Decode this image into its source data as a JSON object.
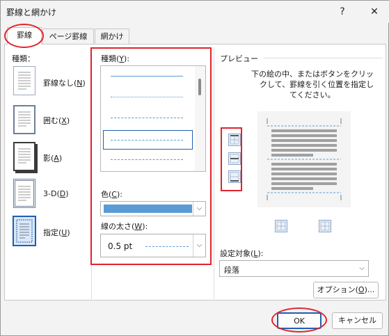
{
  "window": {
    "title": "罫線と網かけ",
    "help": "?",
    "close": "✕"
  },
  "tabs": [
    "罫線",
    "ページ罫線",
    "網かけ"
  ],
  "settings": {
    "heading": "種類：",
    "items": [
      {
        "label": "罫線なし(",
        "key": "N",
        "end": ")"
      },
      {
        "label": "囲む(",
        "key": "X",
        "end": ")"
      },
      {
        "label": "影(",
        "key": "A",
        "end": ")"
      },
      {
        "label": "3-D(",
        "key": "D",
        "end": ")"
      },
      {
        "label": "指定(",
        "key": "U",
        "end": ")"
      }
    ]
  },
  "style": {
    "heading": "種類(",
    "heading_key": "Y",
    "heading_end": "):",
    "color_label": "色(",
    "color_key": "C",
    "color_end": "):",
    "color_value": "#5a9bd5",
    "width_label": "線の太さ(",
    "width_key": "W",
    "width_end": "):",
    "width_value": "0.5 pt"
  },
  "preview": {
    "heading": "プレビュー",
    "instructions": [
      "下の絵の中、またはボタンをクリッ",
      "クして、罫線を引く位置を指定し",
      "てください。"
    ]
  },
  "apply_to": {
    "label": "設定対象(",
    "key": "L",
    "end": "):",
    "value": "段落"
  },
  "buttons": {
    "options": "オプション(",
    "options_key": "O",
    "options_end": ")...",
    "ok": "OK",
    "cancel": "キャンセル"
  },
  "colors": {
    "highlight": "#e0232b",
    "accent": "#1f5fb0"
  }
}
